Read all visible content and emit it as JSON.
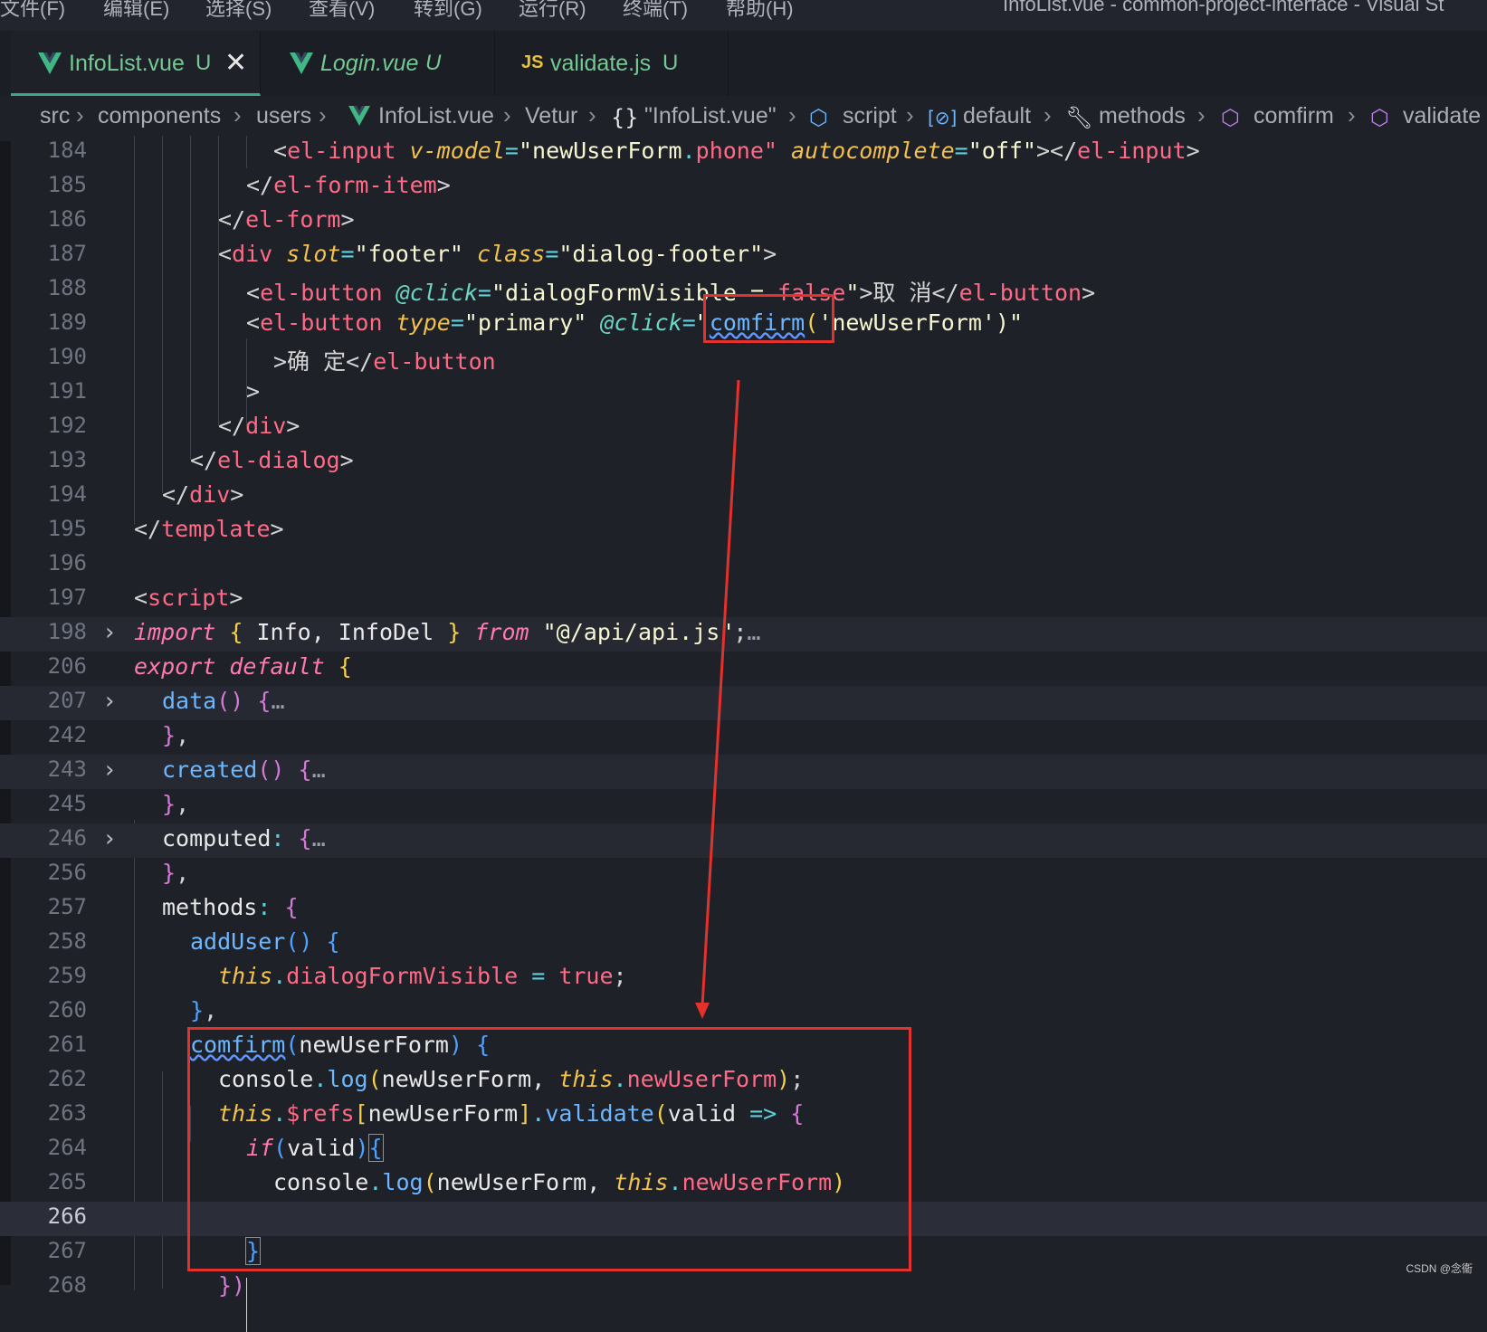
{
  "menubar": {
    "items": [
      "文件(F)",
      "编辑(E)",
      "选择(S)",
      "查看(V)",
      "转到(G)",
      "运行(R)",
      "终端(T)",
      "帮助(H)"
    ],
    "window_title": "InfoList.vue - common-project-interface - Visual St"
  },
  "tabs": [
    {
      "label": "InfoList.vue",
      "mark": "U",
      "active": true,
      "icon": "vue-icon"
    },
    {
      "label": "Login.vue",
      "mark": "U",
      "active": false,
      "icon": "vue-icon"
    },
    {
      "label": "validate.js",
      "mark": "U",
      "active": false,
      "icon": "js-icon"
    }
  ],
  "breadcrumb": [
    "src",
    "components",
    "users",
    "InfoList.vue",
    "Vetur",
    "\"InfoList.vue\"",
    "script",
    "default",
    "methods",
    "comfirm",
    "validate"
  ],
  "line_numbers": [
    "184",
    "185",
    "186",
    "187",
    "188",
    "189",
    "190",
    "191",
    "192",
    "193",
    "194",
    "195",
    "196",
    "197",
    "198",
    "206",
    "207",
    "242",
    "243",
    "245",
    "246",
    "256",
    "257",
    "258",
    "259",
    "260",
    "261",
    "262",
    "263",
    "264",
    "265",
    "266",
    "267",
    "268"
  ],
  "code": {
    "l184": [
      "<",
      "el-input",
      " ",
      "v-model",
      "=",
      "\"newUserForm",
      ".",
      "phone\"",
      " ",
      "autocomplete",
      "=",
      "\"off\"",
      "></",
      "el-input",
      ">"
    ],
    "l185": [
      "</",
      "el-form-item",
      ">"
    ],
    "l186": [
      "</",
      "el-form",
      ">"
    ],
    "l187": [
      "<",
      "div",
      " ",
      "slot",
      "=",
      "\"footer\"",
      " ",
      "class",
      "=",
      "\"dialog-footer\"",
      ">"
    ],
    "l188": [
      "<",
      "el-button",
      " ",
      "@click",
      "=",
      "\"dialogFormVisible = ",
      "false",
      "\"",
      ">取 消</",
      "el-button",
      ">"
    ],
    "l189": [
      "<",
      "el-button",
      " ",
      "type",
      "=",
      "\"primary\"",
      " ",
      "@click",
      "=",
      "\"",
      "comfirm",
      "(",
      "'newUserForm'",
      ")\""
    ],
    "l190": [
      ">确 定</",
      "el-button"
    ],
    "l191": [
      ">"
    ],
    "l192": [
      "</",
      "div",
      ">"
    ],
    "l193": [
      "</",
      "el-dialog",
      ">"
    ],
    "l194": [
      "</",
      "div",
      ">"
    ],
    "l195": [
      "</",
      "template",
      ">"
    ],
    "l197": [
      "<",
      "script",
      ">"
    ],
    "l198": [
      "import",
      " ",
      "{",
      " Info, InfoDel ",
      "}",
      " ",
      "from",
      " ",
      "\"@/api/api.js\"",
      ";",
      "…"
    ],
    "l206": [
      "export",
      " ",
      "default",
      " ",
      "{"
    ],
    "l207": [
      "data",
      "()",
      " ",
      "{",
      "…"
    ],
    "l242": [
      "}",
      ","
    ],
    "l243": [
      "created",
      "()",
      " ",
      "{",
      "…"
    ],
    "l245": [
      "}",
      ","
    ],
    "l246": [
      "computed",
      ":",
      " ",
      "{",
      "…"
    ],
    "l256": [
      "}",
      ","
    ],
    "l257": [
      "methods",
      ":",
      " ",
      "{"
    ],
    "l258": [
      "addUser",
      "()",
      " ",
      "{"
    ],
    "l259": [
      "this",
      ".",
      "dialogFormVisible",
      " = ",
      "true",
      ";"
    ],
    "l260": [
      "}",
      ","
    ],
    "l261": [
      "comfirm",
      "(",
      "newUserForm",
      ")",
      " ",
      "{"
    ],
    "l262": [
      "console",
      ".",
      "log",
      "(",
      "newUserForm, ",
      "this",
      ".",
      "newUserForm",
      ")",
      ";"
    ],
    "l263": [
      "this",
      ".",
      "$refs",
      "[",
      "newUserForm",
      "]",
      ".",
      "validate",
      "(",
      "valid",
      " => ",
      "{"
    ],
    "l264": [
      "if",
      "(",
      "valid",
      ")",
      "{"
    ],
    "l265": [
      "console",
      ".",
      "log",
      "(",
      "newUserForm, ",
      "this",
      ".",
      "newUserForm",
      ")"
    ],
    "l267": [
      "}"
    ],
    "l268": [
      "})"
    ]
  },
  "watermark": "CSDN @念衞",
  "colors": {
    "annotation": "#e3312b",
    "background": "#1f2129",
    "vue_green": "#41b883"
  }
}
